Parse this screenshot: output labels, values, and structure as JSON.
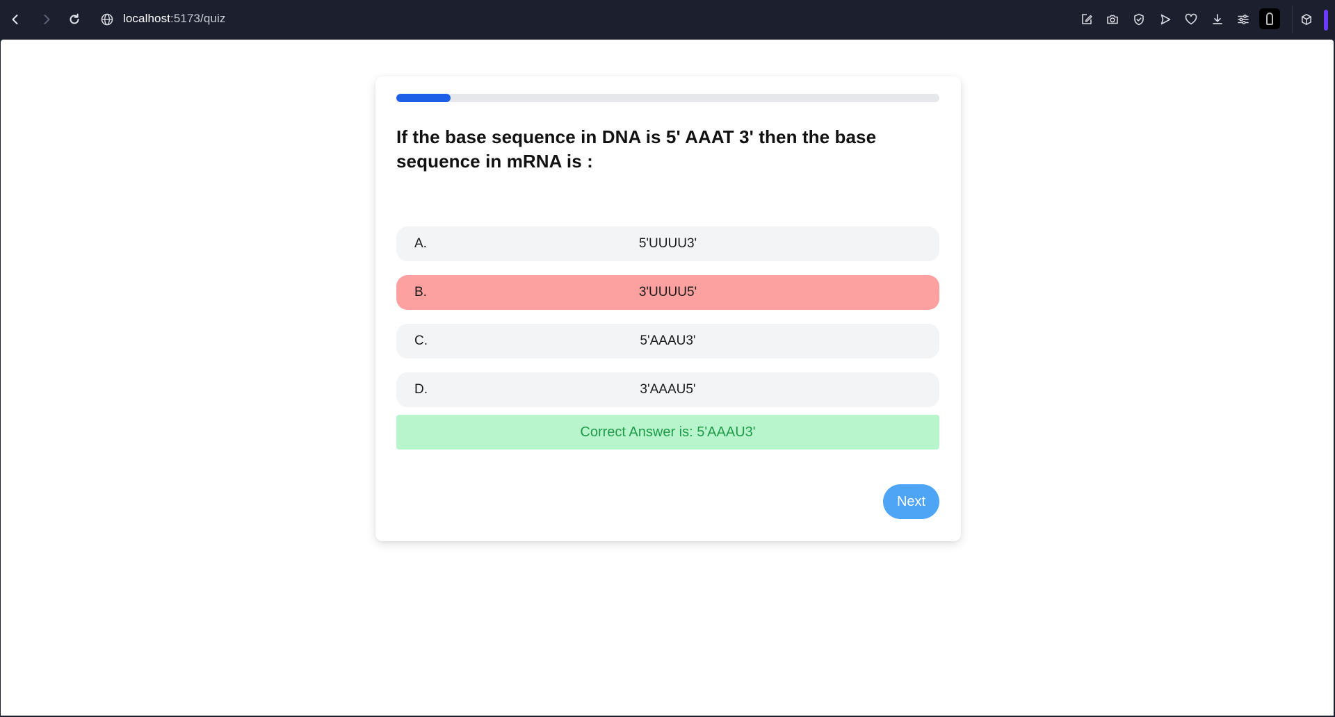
{
  "browser": {
    "url_host": "localhost",
    "url_path": ":5173/quiz",
    "icons": [
      "back-icon",
      "forward-icon",
      "reload-icon",
      "globe-icon",
      "edit-icon",
      "camera-icon",
      "shield-icon",
      "send-icon",
      "heart-icon",
      "download-icon",
      "sliders-icon",
      "extension-avatar-icon",
      "cube-icon"
    ]
  },
  "quiz": {
    "progress_fraction": 0.1,
    "question": "If the base sequence in DNA is 5' AAAT 3' then the base sequence in mRNA is :",
    "options": [
      {
        "letter": "A.",
        "text": "5'UUUU3'",
        "state": "default"
      },
      {
        "letter": "B.",
        "text": "3'UUUU5'",
        "state": "selected-wrong"
      },
      {
        "letter": "C.",
        "text": "5'AAAU3'",
        "state": "default"
      },
      {
        "letter": "D.",
        "text": "3'AAAU5'",
        "state": "default"
      }
    ],
    "answer_text": "Correct Answer is: 5'AAAU3'",
    "next_label": "Next"
  },
  "colors": {
    "progress": "#1d5fe6",
    "wrong": "#fca0a0",
    "correct_bg": "#b8f5cd",
    "correct_text": "#1e9a48",
    "next_button": "#4ea4f5"
  }
}
